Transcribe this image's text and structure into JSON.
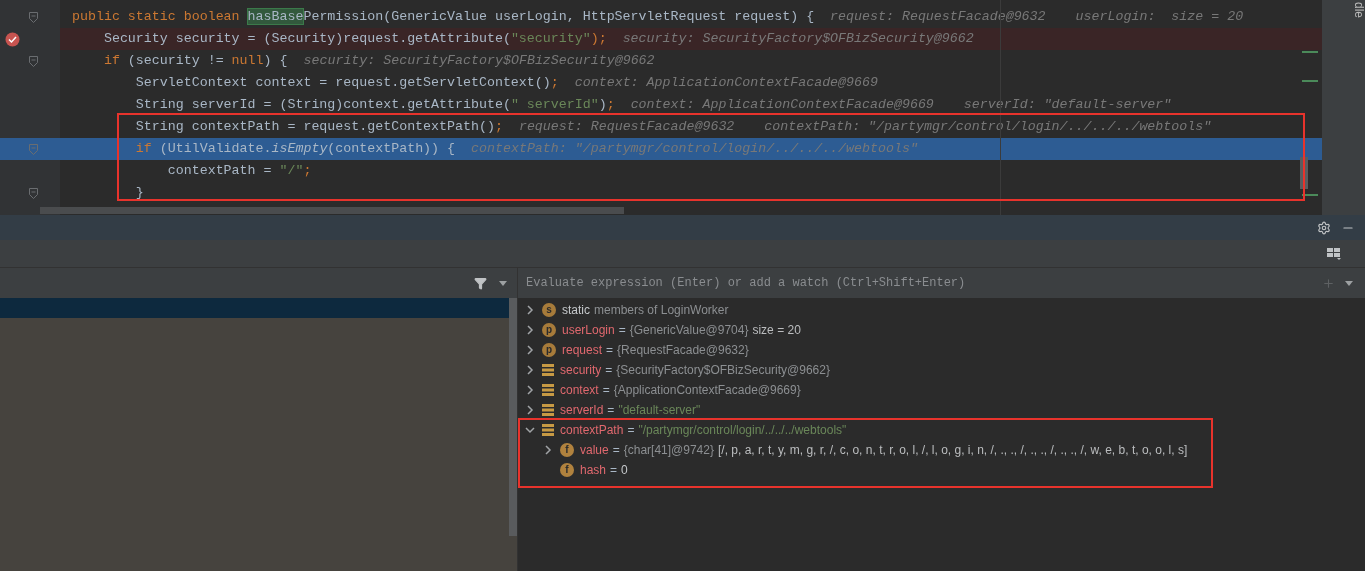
{
  "editor": {
    "lines": [
      {
        "fold": true,
        "breakpoint": false,
        "current": false,
        "tokens": [
          {
            "t": "public static boolean ",
            "kind": "kw"
          },
          {
            "t": "hasBase",
            "kind": "match"
          },
          {
            "t": "Permission(GenericValue userLogin, HttpServletRequest request) {",
            "kind": "plain"
          }
        ],
        "hints": [
          "request: RequestFacade@9632",
          "userLogin:  size = 20"
        ]
      },
      {
        "fold": false,
        "breakpoint": true,
        "current": false,
        "tokens": [
          {
            "t": "    Security security = (Security)request.getAttribute(",
            "kind": "plain"
          },
          {
            "t": "\"security\"",
            "kind": "str"
          },
          {
            "t": ");",
            "kind": "kw"
          }
        ],
        "hints": [
          "security: SecurityFactory$OFBizSecurity@9662"
        ]
      },
      {
        "fold": true,
        "breakpoint": false,
        "current": false,
        "tokens": [
          {
            "t": "    if",
            "kind": "kw"
          },
          {
            "t": " (security != ",
            "kind": "plain"
          },
          {
            "t": "null",
            "kind": "kw"
          },
          {
            "t": ") {",
            "kind": "plain"
          }
        ],
        "hints": [
          "security: SecurityFactory$OFBizSecurity@9662"
        ]
      },
      {
        "fold": false,
        "breakpoint": false,
        "current": false,
        "tokens": [
          {
            "t": "        ServletContext context = request.getServletContext()",
            "kind": "plain"
          },
          {
            "t": ";",
            "kind": "kw"
          }
        ],
        "hints": [
          "context: ApplicationContextFacade@9669"
        ]
      },
      {
        "fold": false,
        "breakpoint": false,
        "current": false,
        "tokens": [
          {
            "t": "        String serverId = (String)context.getAttribute(",
            "kind": "plain"
          },
          {
            "t": "\" serverId\"",
            "kind": "str"
          },
          {
            "t": ")",
            "kind": "plain"
          },
          {
            "t": ";",
            "kind": "kw"
          }
        ],
        "hints": [
          "context: ApplicationContextFacade@9669",
          "serverId: \"default-server\""
        ]
      },
      {
        "fold": false,
        "breakpoint": false,
        "current": false,
        "tokens": [
          {
            "t": "        String contextPath = request.getContextPath()",
            "kind": "plain"
          },
          {
            "t": ";",
            "kind": "kw"
          }
        ],
        "hints": [
          "request: RequestFacade@9632",
          "contextPath: \"/partymgr/control/login/../../../webtools\""
        ]
      },
      {
        "fold": true,
        "breakpoint": false,
        "current": true,
        "tokens": [
          {
            "t": "        if",
            "kind": "kw"
          },
          {
            "t": " (UtilValidate.",
            "kind": "plain"
          },
          {
            "t": "isEmpty",
            "kind": "italic"
          },
          {
            "t": "(contextPath)) {",
            "kind": "plain"
          }
        ],
        "hints": [
          "contextPath: \"/partymgr/control/login/../../../webtools\""
        ]
      },
      {
        "fold": false,
        "breakpoint": false,
        "current": false,
        "tokens": [
          {
            "t": "            contextPath = ",
            "kind": "plain"
          },
          {
            "t": "\"/\"",
            "kind": "str"
          },
          {
            "t": ";",
            "kind": "kw"
          }
        ]
      },
      {
        "fold": true,
        "breakpoint": false,
        "current": false,
        "tokens": [
          {
            "t": "        }",
            "kind": "plain"
          }
        ]
      }
    ]
  },
  "side_strip": {
    "label": "dle"
  },
  "watch": {
    "placeholder": "Evaluate expression (Enter) or add a watch (Ctrl+Shift+Enter)"
  },
  "variables": [
    {
      "kind": "static",
      "icon": "s",
      "name": "static",
      "ref": "members of LoginWorker",
      "expandable": true,
      "expanded": false
    },
    {
      "kind": "param",
      "icon": "p",
      "name": "userLogin",
      "sep": "=",
      "ref": "{GenericValue@9704}",
      "extra": "size = 20",
      "expandable": true,
      "expanded": false
    },
    {
      "kind": "param",
      "icon": "p",
      "name": "request",
      "sep": "=",
      "ref": "{RequestFacade@9632}",
      "expandable": true,
      "expanded": false
    },
    {
      "kind": "local",
      "name": "security",
      "sep": "=",
      "ref": "{SecurityFactory$OFBizSecurity@9662}",
      "expandable": true,
      "expanded": false
    },
    {
      "kind": "local",
      "name": "context",
      "sep": "=",
      "ref": "{ApplicationContextFacade@9669}",
      "expandable": true,
      "expanded": false
    },
    {
      "kind": "local",
      "name": "serverId",
      "sep": "=",
      "string": "\"default-server\"",
      "expandable": true,
      "expanded": false
    },
    {
      "kind": "local",
      "name": "contextPath",
      "sep": "=",
      "string": "\"/partymgr/control/login/../../../webtools\"",
      "expandable": true,
      "expanded": true,
      "children": [
        {
          "kind": "field",
          "icon": "f",
          "name": "value",
          "sep": "=",
          "ref": "{char[41]@9742}",
          "extra": "[/, p, a, r, t, y, m, g, r, /, c, o, n, t, r, o, l, /, l, o, g, i, n, /, ., ., /, ., ., /, ., ., /, w, e, b, t, o, o, l, s]",
          "expandable": true,
          "expanded": false
        },
        {
          "kind": "field",
          "icon": "f",
          "name": "hash",
          "sep": "=",
          "plain": "0",
          "expandable": false
        }
      ]
    }
  ]
}
